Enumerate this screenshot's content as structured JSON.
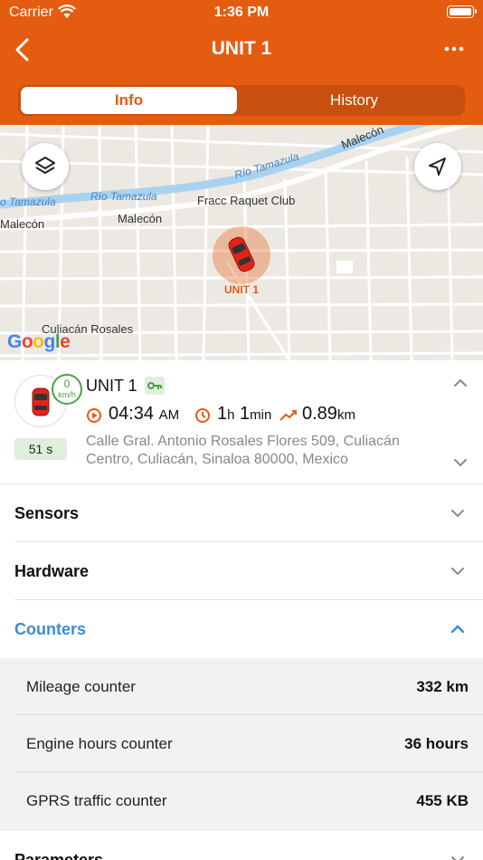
{
  "status_bar": {
    "carrier": "Carrier",
    "time": "1:36 PM"
  },
  "nav": {
    "title": "UNIT 1"
  },
  "tabs": [
    {
      "label": "Info",
      "selected": true
    },
    {
      "label": "History",
      "selected": false
    }
  ],
  "map": {
    "labels": {
      "rio1": "Río Tamazula",
      "rio2": "Río Tamazula",
      "rio3": "o Tamazula",
      "malecon1": "Malecón",
      "malecon2": "Malecón",
      "malecon3": "Malecón",
      "fracc": "Fracc Raquet Club",
      "culiacan": "Culiacán Rosales"
    },
    "marker_label": "UNIT 1",
    "google_logo": "Google"
  },
  "unit": {
    "name": "UNIT 1",
    "speed": "0",
    "speed_unit": "km/h",
    "time_ago": "51 s",
    "time": "04:34",
    "time_suffix": "AM",
    "duration_h": "1",
    "duration_h_unit": "h",
    "duration_m": "1",
    "duration_m_unit": "min",
    "mileage": "0.89",
    "mileage_unit": "km",
    "address": "Calle Gral. Antonio Rosales Flores 509, Culiacán Centro, Culiacán, Sinaloa 80000, Mexico"
  },
  "sections": {
    "sensors": "Sensors",
    "hardware": "Hardware",
    "counters": "Counters",
    "parameters": "Parameters"
  },
  "counters": [
    {
      "name": "Mileage counter",
      "value": "332 km"
    },
    {
      "name": "Engine hours counter",
      "value": "36 hours"
    },
    {
      "name": "GPRS traffic counter",
      "value": "455 KB"
    }
  ],
  "colors": {
    "brand": "#e45c10",
    "accent_blue": "#3a8be0",
    "status_green": "#4aa14a"
  }
}
